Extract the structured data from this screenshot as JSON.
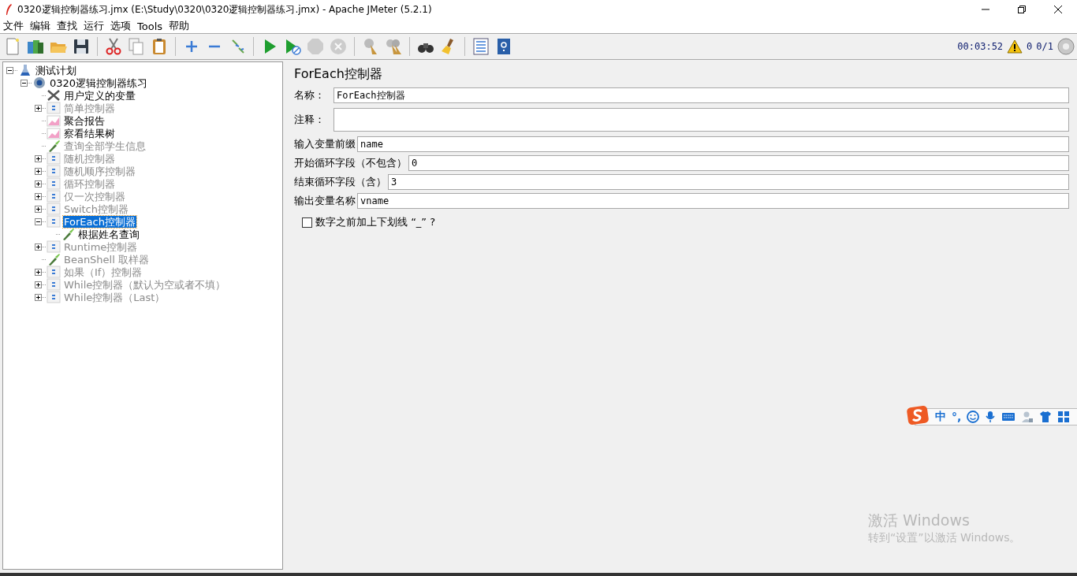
{
  "window": {
    "title": "0320逻辑控制器练习.jmx (E:\\Study\\0320\\0320逻辑控制器练习.jmx) - Apache JMeter (5.2.1)"
  },
  "menu": [
    {
      "label": "文件"
    },
    {
      "label": "编辑"
    },
    {
      "label": "查找"
    },
    {
      "label": "运行"
    },
    {
      "label": "选项"
    },
    {
      "label": "Tools"
    },
    {
      "label": "帮助"
    }
  ],
  "toolbar": [
    {
      "buttons": [
        {
          "kind": "new",
          "disabled": false
        },
        {
          "kind": "templates",
          "disabled": false
        },
        {
          "kind": "open",
          "disabled": false
        },
        {
          "kind": "save",
          "disabled": false
        }
      ]
    },
    {
      "buttons": [
        {
          "kind": "cut",
          "disabled": false
        },
        {
          "kind": "copy",
          "disabled": false
        },
        {
          "kind": "paste",
          "disabled": false
        }
      ]
    },
    {
      "buttons": [
        {
          "kind": "expand",
          "disabled": false
        },
        {
          "kind": "collapse",
          "disabled": false
        },
        {
          "kind": "toggle",
          "disabled": false
        }
      ]
    },
    {
      "buttons": [
        {
          "kind": "start",
          "disabled": false
        },
        {
          "kind": "start-no-pause",
          "disabled": false
        },
        {
          "kind": "stop",
          "disabled": true
        },
        {
          "kind": "shutdown",
          "disabled": true
        }
      ]
    },
    {
      "buttons": [
        {
          "kind": "clear",
          "disabled": false
        },
        {
          "kind": "clear-all",
          "disabled": false
        }
      ]
    },
    {
      "buttons": [
        {
          "kind": "search",
          "disabled": false
        },
        {
          "kind": "reset-search",
          "disabled": false
        }
      ]
    },
    {
      "buttons": [
        {
          "kind": "function-helper",
          "disabled": false
        },
        {
          "kind": "help",
          "disabled": false
        }
      ]
    }
  ],
  "status": {
    "elapsed": "00:03:52",
    "warnings": "0",
    "threads": "0/1"
  },
  "tree": [
    {
      "label": "测试计划",
      "kind": "plan",
      "disabled": false,
      "selected": false,
      "expanded": true,
      "children": [
        {
          "label": "0320逻辑控制器练习",
          "kind": "thread-group",
          "disabled": false,
          "selected": false,
          "expanded": true,
          "children": [
            {
              "label": "用户定义的变量",
              "kind": "config",
              "disabled": false,
              "selected": false
            },
            {
              "label": "简单控制器",
              "kind": "controller",
              "disabled": true,
              "selected": false,
              "expanded": false
            },
            {
              "label": "聚合报告",
              "kind": "listener",
              "disabled": false,
              "selected": false
            },
            {
              "label": "察看结果树",
              "kind": "listener",
              "disabled": false,
              "selected": false
            },
            {
              "label": "查询全部学生信息",
              "kind": "sampler",
              "disabled": true,
              "selected": false
            },
            {
              "label": "随机控制器",
              "kind": "controller",
              "disabled": true,
              "selected": false,
              "expanded": false
            },
            {
              "label": "随机顺序控制器",
              "kind": "controller",
              "disabled": true,
              "selected": false,
              "expanded": false
            },
            {
              "label": "循环控制器",
              "kind": "controller",
              "disabled": true,
              "selected": false,
              "expanded": false
            },
            {
              "label": "仅一次控制器",
              "kind": "controller",
              "disabled": true,
              "selected": false,
              "expanded": false
            },
            {
              "label": "Switch控制器",
              "kind": "controller",
              "disabled": true,
              "selected": false,
              "expanded": false
            },
            {
              "label": "ForEach控制器",
              "kind": "controller",
              "disabled": false,
              "selected": true,
              "expanded": true,
              "children": [
                {
                  "label": "根据姓名查询",
                  "kind": "sampler",
                  "disabled": false,
                  "selected": false
                }
              ]
            },
            {
              "label": "Runtime控制器",
              "kind": "controller",
              "disabled": true,
              "selected": false,
              "expanded": false
            },
            {
              "label": "BeanShell 取样器",
              "kind": "sampler",
              "disabled": true,
              "selected": false
            },
            {
              "label": "如果（If）控制器",
              "kind": "controller",
              "disabled": true,
              "selected": false,
              "expanded": false
            },
            {
              "label": "While控制器（默认为空或者不填）",
              "kind": "controller",
              "disabled": true,
              "selected": false,
              "expanded": false
            },
            {
              "label": "While控制器（Last）",
              "kind": "controller",
              "disabled": true,
              "selected": false,
              "expanded": false
            }
          ]
        }
      ]
    }
  ],
  "editor": {
    "title": "ForEach控制器",
    "fields": [
      {
        "label": "名称：",
        "value": "ForEach控制器",
        "kind": "text"
      },
      {
        "label": "注释：",
        "kind": "textarea"
      },
      {
        "label": "输入变量前缀",
        "value": "name",
        "kind": "text"
      },
      {
        "label": "开始循环字段（不包含）",
        "value": "0",
        "kind": "text"
      },
      {
        "label": "结束循环字段（含）",
        "value": "3",
        "kind": "text"
      },
      {
        "label": "输出变量名称",
        "value": "vname",
        "kind": "text"
      }
    ],
    "checkbox": {
      "label": "数字之前加上下划线 “_” ?",
      "checked": false
    }
  },
  "ime_bar": {
    "mode": "中",
    "punctuation": "°,"
  },
  "activation_notice": {
    "title": "激活 Windows",
    "subtitle": "转到“设置”以激活 Windows。"
  }
}
